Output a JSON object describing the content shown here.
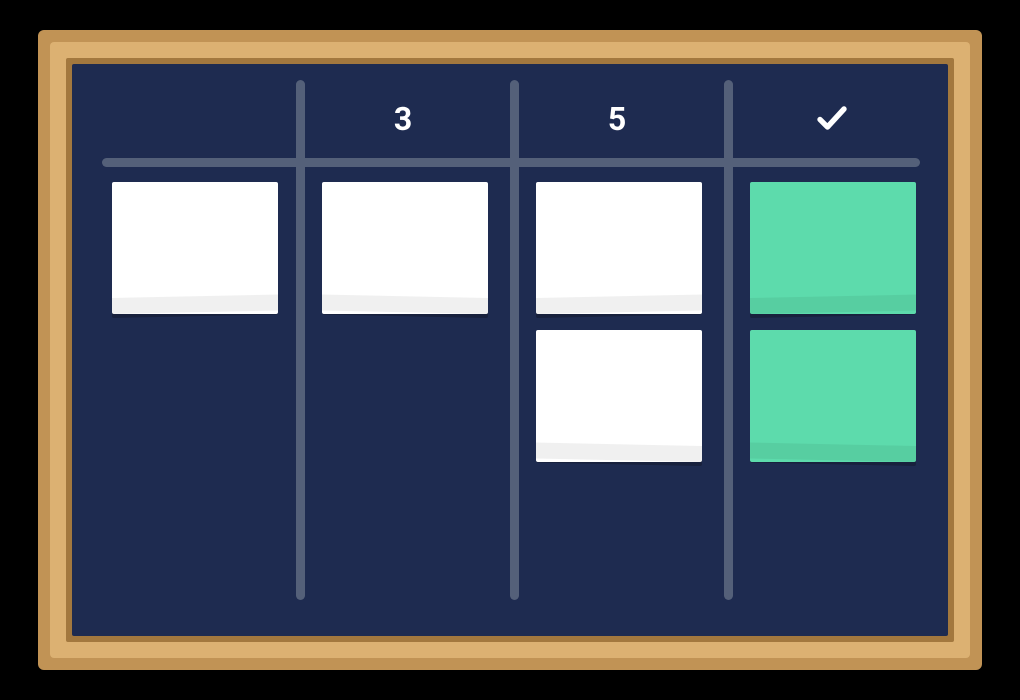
{
  "colors": {
    "background": "#000000",
    "frame_outer": "#c19355",
    "frame_light": "#dcb172",
    "frame_bevel": "#a3783e",
    "board": "#1e2b50",
    "rule": "#546079",
    "card_white": "#ffffff",
    "card_green": "#5ddbac",
    "header_text": "#ffffff"
  },
  "board": {
    "columns": [
      {
        "id": "col-1",
        "header": "",
        "header_kind": "none",
        "cards": [
          {
            "color": "white"
          }
        ]
      },
      {
        "id": "col-2",
        "header": "3",
        "header_kind": "text",
        "cards": [
          {
            "color": "white"
          }
        ]
      },
      {
        "id": "col-3",
        "header": "5",
        "header_kind": "text",
        "cards": [
          {
            "color": "white"
          },
          {
            "color": "white"
          }
        ]
      },
      {
        "id": "col-4",
        "header": "",
        "header_kind": "check",
        "cards": [
          {
            "color": "green"
          },
          {
            "color": "green"
          }
        ]
      }
    ]
  }
}
